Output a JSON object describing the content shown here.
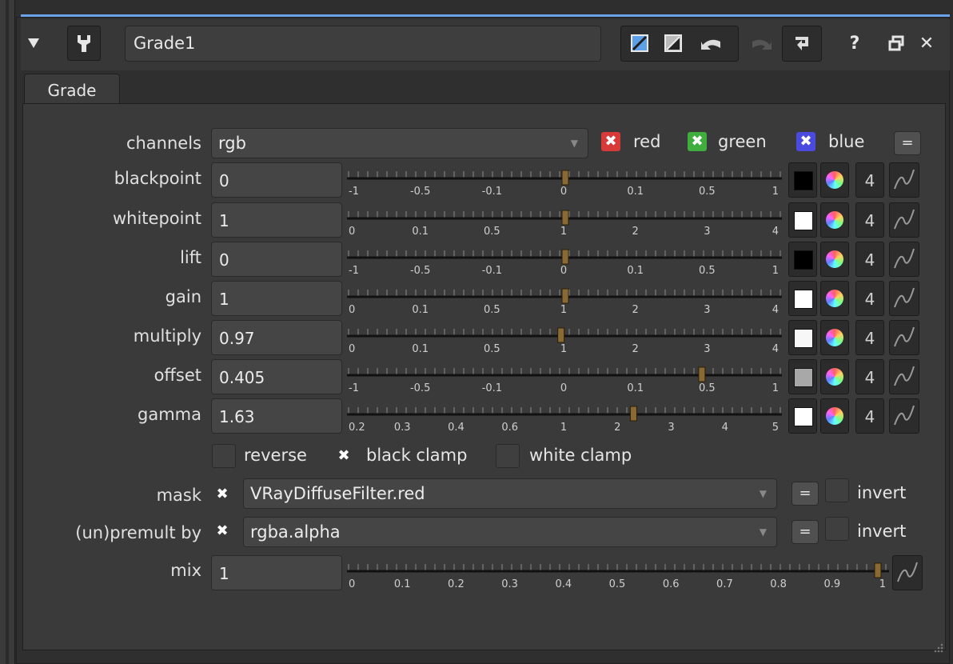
{
  "window": {
    "node_name": "Grade1",
    "help_label": "?",
    "close_label": "✕"
  },
  "tabs": [
    {
      "label": "Grade"
    }
  ],
  "channels": {
    "label": "channels",
    "value": "rgb",
    "red_label": "red",
    "green_label": "green",
    "blue_label": "blue",
    "eq_label": "="
  },
  "params": [
    {
      "label": "blackpoint",
      "value": "0",
      "ticks": [
        "-1",
        "-0.5",
        "-0.1",
        "0",
        "0.1",
        "0.5",
        "1"
      ],
      "swatch": "#000000",
      "num": "4"
    },
    {
      "label": "whitepoint",
      "value": "1",
      "ticks": [
        "0",
        "0.1",
        "0.5",
        "1",
        "2",
        "3",
        "4"
      ],
      "swatch": "#ffffff",
      "num": "4"
    },
    {
      "label": "lift",
      "value": "0",
      "ticks": [
        "-1",
        "-0.5",
        "-0.1",
        "0",
        "0.1",
        "0.5",
        "1"
      ],
      "swatch": "#000000",
      "num": "4"
    },
    {
      "label": "gain",
      "value": "1",
      "ticks": [
        "0",
        "0.1",
        "0.5",
        "1",
        "2",
        "3",
        "4"
      ],
      "swatch": "#ffffff",
      "num": "4"
    },
    {
      "label": "multiply",
      "value": "0.97",
      "ticks": [
        "0",
        "0.1",
        "0.5",
        "1",
        "2",
        "3",
        "4"
      ],
      "swatch": "#f7f7f7",
      "num": "4"
    },
    {
      "label": "offset",
      "value": "0.405",
      "ticks": [
        "-1",
        "-0.5",
        "-0.1",
        "0",
        "0.1",
        "0.5",
        "1"
      ],
      "swatch": "#a8a8a8",
      "num": "4"
    },
    {
      "label": "gamma",
      "value": "1.63",
      "ticks": [
        "0.2",
        "0.3",
        "0.4",
        "0.6",
        "1",
        "2",
        "3",
        "4",
        "5"
      ],
      "swatch": "#ffffff",
      "num": "4"
    }
  ],
  "options": {
    "reverse_label": "reverse",
    "black_clamp_label": "black clamp",
    "white_clamp_label": "white clamp"
  },
  "mask": {
    "label": "mask",
    "value": "VRayDiffuseFilter.red",
    "eq_label": "=",
    "invert_label": "invert"
  },
  "premult": {
    "label": "(un)premult by",
    "value": "rgba.alpha",
    "eq_label": "=",
    "invert_label": "invert"
  },
  "mix": {
    "label": "mix",
    "value": "1",
    "ticks": [
      "0",
      "0.1",
      "0.2",
      "0.3",
      "0.4",
      "0.5",
      "0.6",
      "0.7",
      "0.8",
      "0.9",
      "1"
    ]
  },
  "colors": {
    "accent": "#6ba2e6",
    "red_check": "#d83a3a",
    "green_check": "#3fae3f",
    "blue_check": "#4a4ae0",
    "handle": "#8a6a34"
  }
}
